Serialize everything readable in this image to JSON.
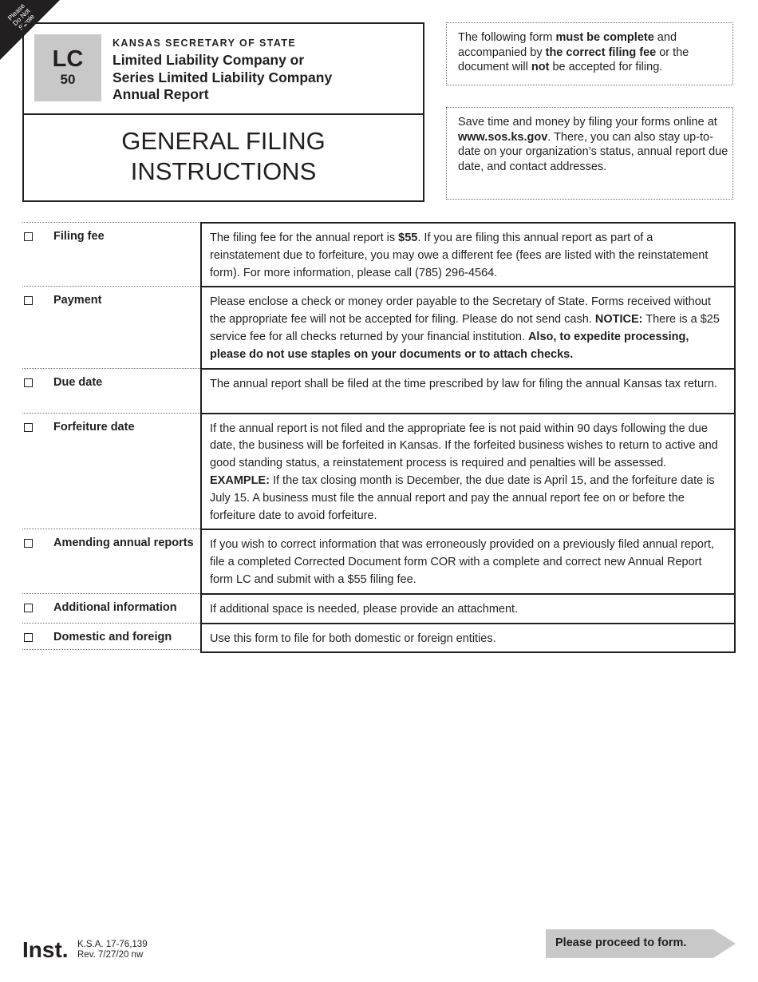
{
  "corner_tab": {
    "lines": [
      "Please",
      "Do Not",
      "Staple"
    ]
  },
  "header": {
    "form_code": "LC",
    "form_number": "50",
    "agency": "KANSAS SECRETARY OF STATE",
    "form_title_lines": [
      "Limited Liability Company or",
      "Series Limited Liability Company",
      "Annual Report"
    ],
    "section_title_lines": [
      "GENERAL FILING",
      "INSTRUCTIONS"
    ]
  },
  "notices": [
    {
      "segments": [
        {
          "text": "The following form ",
          "bold": false
        },
        {
          "text": "must be complete",
          "bold": true
        },
        {
          "text": " and accompanied by ",
          "bold": false
        },
        {
          "text": "the correct filing fee",
          "bold": true
        },
        {
          "text": " or the document will ",
          "bold": false
        },
        {
          "text": "not",
          "bold": true
        },
        {
          "text": " be accepted for filing.",
          "bold": false
        }
      ]
    },
    {
      "segments": [
        {
          "text": "Save time and money by filing your forms online at ",
          "bold": false
        },
        {
          "text": "www.sos.ks.gov",
          "bold": true
        },
        {
          "text": ". There, you can also stay up-to-date on your organization’s status, annual report due date, and contact addresses.",
          "bold": false
        }
      ]
    }
  ],
  "instructions": [
    {
      "label": "Filing fee",
      "checked": false,
      "segments": [
        {
          "text": "The filing fee for the annual report is ",
          "bold": false
        },
        {
          "text": "$55",
          "bold": true
        },
        {
          "text": ".  If you are filing this annual report as part of a reinstatement due to forfeiture, you may owe a different fee (fees are listed with the reinstatement form).  For more information, please call (785) 296-4564.",
          "bold": false
        }
      ]
    },
    {
      "label": "Payment",
      "checked": false,
      "segments": [
        {
          "text": "Please enclose a check or money order payable to the Secretary of State. Forms received without the appropriate fee will not be accepted for filing. Please do not send cash. ",
          "bold": false
        },
        {
          "text": "NOTICE:",
          "bold": true
        },
        {
          "text": " There is a $25 service fee for all checks returned by your financial institution. ",
          "bold": false
        },
        {
          "text": "Also, to expedite processing, please do not use staples on your documents or to attach checks.",
          "bold": true
        }
      ]
    },
    {
      "label": "Due date",
      "checked": false,
      "segments": [
        {
          "text": "The annual report shall be filed at the time prescribed by law for filing the annual Kansas tax return.",
          "bold": false
        }
      ]
    },
    {
      "label": "Forfeiture date",
      "checked": false,
      "segments": [
        {
          "text": "If the annual report is not filed and the appropriate fee is not paid within 90 days following the due date, the business will be forfeited in Kansas. If the forfeited business wishes to return to active and good standing status, a reinstatement process is required and penalties will be assessed. ",
          "bold": false
        },
        {
          "text": "EXAMPLE:",
          "bold": true
        },
        {
          "text": "  If the tax closing month is December, the due date is April 15, and the forfeiture date is July 15.  A business must file the annual report and pay the annual report fee on or before the forfeiture date to avoid forfeiture.",
          "bold": false
        }
      ]
    },
    {
      "label": "Amending annual reports",
      "checked": false,
      "segments": [
        {
          "text": "If you wish to correct information that was erroneously provided on a previously filed annual report, file a completed Corrected Document form COR with a complete and correct new Annual Report form LC and submit with a $55 filing fee.",
          "bold": false
        }
      ]
    },
    {
      "label": "Additional information",
      "checked": false,
      "segments": [
        {
          "text": "If additional space is needed, please provide an attachment.",
          "bold": false
        }
      ]
    },
    {
      "label": "Domestic and foreign",
      "checked": false,
      "segments": [
        {
          "text": "Use this form to file for both domestic or foreign entities.",
          "bold": false
        }
      ]
    }
  ],
  "footer": {
    "inst_label": "Inst.",
    "statute": "K.S.A. 17-76,139",
    "revision": "Rev. 7/27/20 nw",
    "proceed_label": "Please proceed to form."
  },
  "colors": {
    "ink": "#231f20",
    "badge_gray": "#c8c8c8",
    "proceed_gray": "#c8c8c8",
    "dotted_rule": "#6d6e71"
  }
}
